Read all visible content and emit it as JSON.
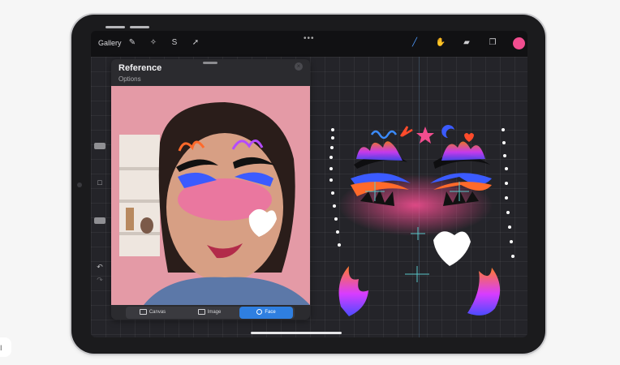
{
  "toolbar": {
    "gallery_label": "Gallery",
    "more_icon": "•••",
    "active_color": "#f14d8f"
  },
  "reference_panel": {
    "title": "Reference",
    "subtitle": "Options",
    "tabs": [
      {
        "label": "Canvas",
        "active": false
      },
      {
        "label": "Image",
        "active": false
      },
      {
        "label": "Face",
        "active": true
      }
    ]
  },
  "colors": {
    "accent": "#2f7fe0",
    "face_paint_pink": "#f14d8f",
    "face_paint_blue": "#3b5bff",
    "face_paint_orange": "#ff6a2b"
  },
  "misc": {
    "edge_label": "I"
  }
}
